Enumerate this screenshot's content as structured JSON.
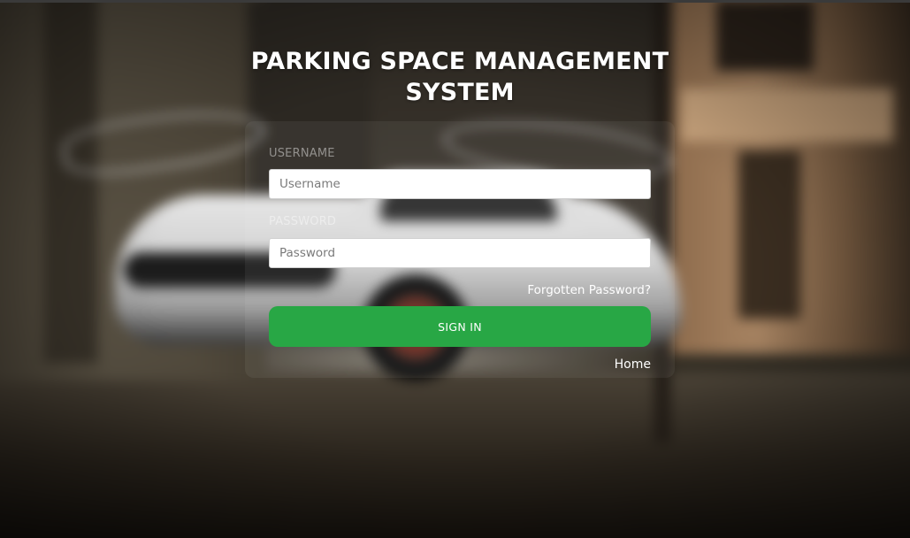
{
  "page": {
    "title": "PARKING SPACE MANAGEMENT SYSTEM"
  },
  "login": {
    "username_label": "USERNAME",
    "username_placeholder": "Username",
    "username_value": "",
    "password_label": "PASSWORD",
    "password_placeholder": "Password",
    "password_value": "",
    "forgot_link": "Forgotten Password?",
    "signin_button": "SIGN IN",
    "home_link": "Home"
  },
  "colors": {
    "signin_button": "#28a745",
    "text": "#ffffff"
  }
}
